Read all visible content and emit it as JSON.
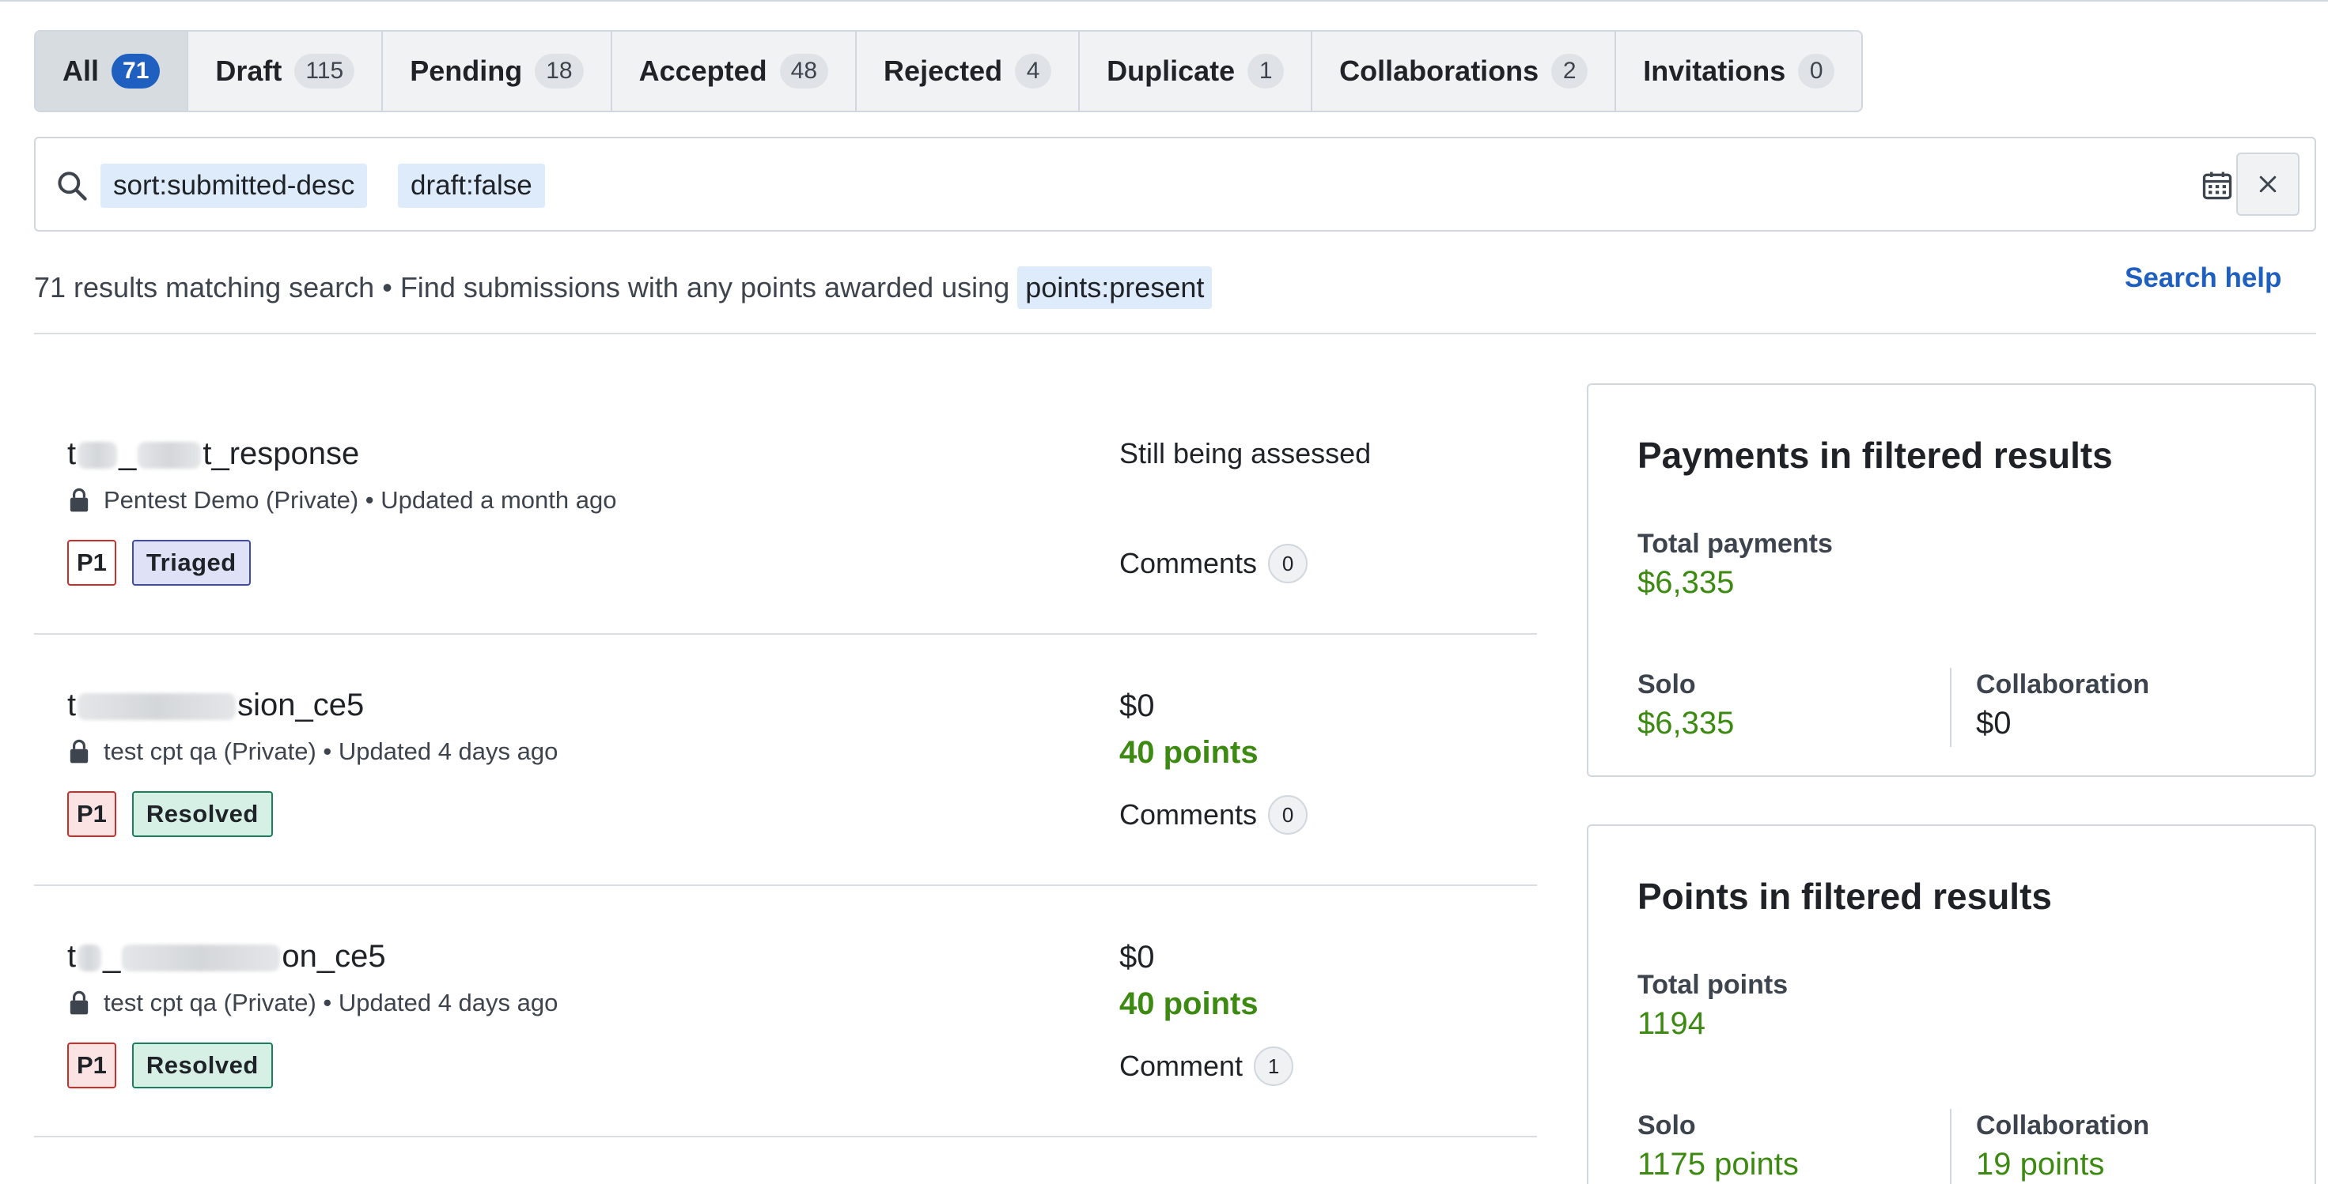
{
  "tabs": [
    {
      "label": "All",
      "count": "71",
      "active": true
    },
    {
      "label": "Draft",
      "count": "115"
    },
    {
      "label": "Pending",
      "count": "18"
    },
    {
      "label": "Accepted",
      "count": "48"
    },
    {
      "label": "Rejected",
      "count": "4"
    },
    {
      "label": "Duplicate",
      "count": "1"
    },
    {
      "label": "Collaborations",
      "count": "2"
    },
    {
      "label": "Invitations",
      "count": "0"
    }
  ],
  "search": {
    "tokens": [
      "sort:submitted-desc",
      "draft:false"
    ],
    "value": "",
    "calendar_icon": "calendar-icon",
    "clear_icon": "close-icon"
  },
  "summary": {
    "text": "71 results matching search • Find submissions with any points awarded using",
    "highlight": "points:present",
    "help_link": "Search help"
  },
  "submissions": [
    {
      "title_start": "t",
      "title_mid": "_",
      "title_end": "t_response",
      "program": "Pentest Demo (Private)",
      "updated": "Updated a month ago",
      "priority": "P1",
      "state": "Triaged",
      "status": "Still being assessed",
      "comments_label": "Comments",
      "comments": "0"
    },
    {
      "title_start": "t",
      "title_mid": "",
      "title_end": "sion_ce5",
      "program": "test cpt qa (Private)",
      "updated": "Updated 4 days ago",
      "priority": "P1",
      "state": "Resolved",
      "amount": "$0",
      "points": "40 points",
      "comments_label": "Comments",
      "comments": "0"
    },
    {
      "title_start": "t",
      "title_mid": "_",
      "title_end": "on_ce5",
      "program": "test cpt qa (Private)",
      "updated": "Updated 4 days ago",
      "priority": "P1",
      "state": "Resolved",
      "amount": "$0",
      "points": "40 points",
      "comments_label": "Comment",
      "comments": "1"
    }
  ],
  "meta_separator": "•",
  "payments_card": {
    "title": "Payments in filtered results",
    "total_label": "Total payments",
    "total_value": "$6,335",
    "solo_label": "Solo",
    "solo_value": "$6,335",
    "collab_label": "Collaboration",
    "collab_value": "$0"
  },
  "points_card": {
    "title": "Points in filtered results",
    "total_label": "Total points",
    "total_value": "1194",
    "solo_label": "Solo",
    "solo_value": "1175 points",
    "collab_label": "Collaboration",
    "collab_value": "19 points"
  },
  "colors": {
    "accent": "#1f5fbf",
    "points_green": "#3d8a12",
    "priority_border": "#c9302c",
    "triaged_border": "#3f4bb2",
    "resolved_border": "#1a7f5a"
  }
}
